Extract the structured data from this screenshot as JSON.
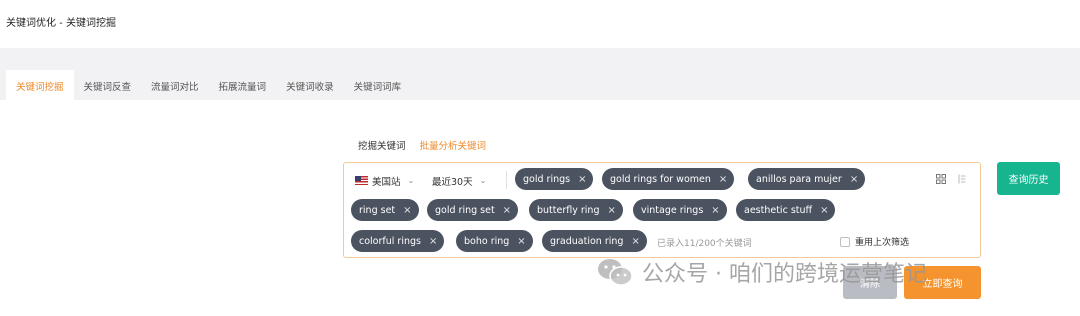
{
  "breadcrumb": "关键词优化 - 关键词挖掘",
  "tabs": [
    {
      "label": "关键词挖掘",
      "active": true
    },
    {
      "label": "关键词反查"
    },
    {
      "label": "流量词对比"
    },
    {
      "label": "拓展流量词"
    },
    {
      "label": "关键词收录"
    },
    {
      "label": "关键词词库"
    }
  ],
  "subtabs": [
    {
      "label": "挖掘关键词"
    },
    {
      "label": "批量分析关键词",
      "active": true
    }
  ],
  "filters": {
    "site": "美国站",
    "period": "最近30天"
  },
  "keywords": [
    "gold rings",
    "gold rings for women",
    "anillos para mujer",
    "ring set",
    "gold ring set",
    "butterfly ring",
    "vintage rings",
    "aesthetic stuff",
    "colorful rings",
    "boho ring",
    "graduation ring"
  ],
  "keyword_count_note": "已录入11/200个关键词",
  "reuse_filter_label": "重用上次筛选",
  "buttons": {
    "history": "查询历史",
    "clear": "清除",
    "search": "立即查询"
  },
  "watermark": "公众号 · 咱们的跨境运营笔记",
  "colors": {
    "accent": "#ee8a2a",
    "chip": "#4b5361",
    "history": "#17b58f",
    "search": "#f5942e",
    "clear": "#b9bcc2"
  }
}
